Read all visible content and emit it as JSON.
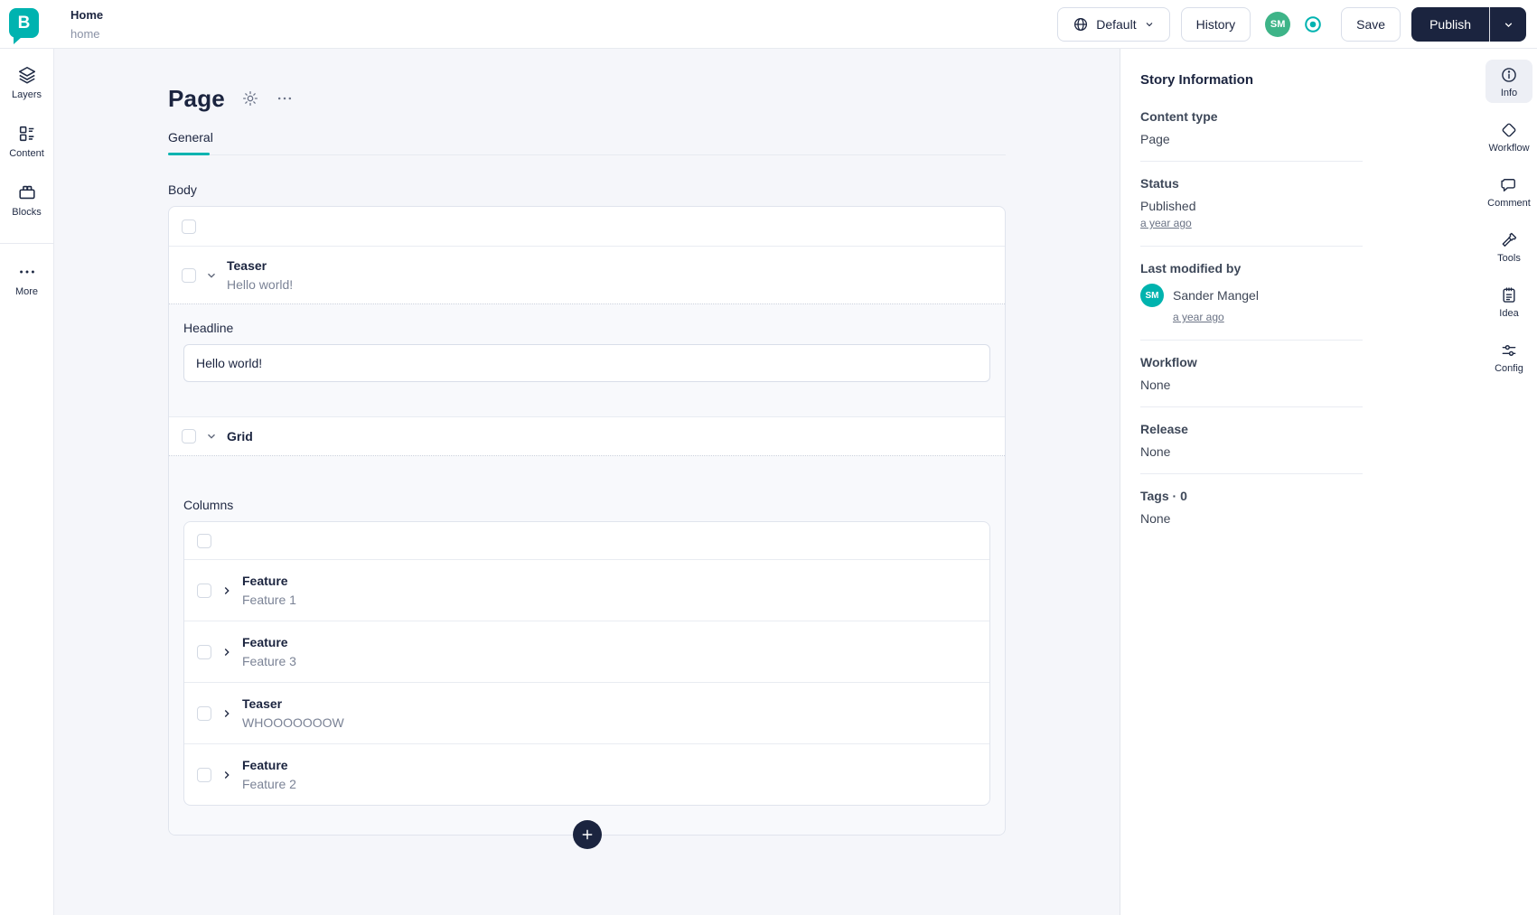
{
  "top_bar": {
    "logo_letter": "B",
    "story_title": "Home",
    "story_slug": "home",
    "language_selector_label": "Default",
    "history_label": "History",
    "avatar_initials": "SM",
    "save_label": "Save",
    "publish_label": "Publish"
  },
  "left_rail": {
    "items": [
      {
        "label": "Layers",
        "icon": "layers-icon"
      },
      {
        "label": "Content",
        "icon": "content-icon"
      },
      {
        "label": "Blocks",
        "icon": "blocks-icon"
      },
      {
        "label": "More",
        "icon": "more-icon"
      }
    ]
  },
  "editor": {
    "page_title": "Page",
    "tabs": [
      {
        "label": "General",
        "active": true
      }
    ],
    "body": {
      "label": "Body",
      "blocks": [
        {
          "type": "Teaser",
          "summary": "Hello world!",
          "expanded": true,
          "fields": [
            {
              "label": "Headline",
              "value": "Hello world!"
            }
          ]
        },
        {
          "type": "Grid",
          "expanded": true,
          "fields": [
            {
              "label": "Columns"
            }
          ],
          "children": [
            {
              "type": "Feature",
              "summary": "Feature 1"
            },
            {
              "type": "Feature",
              "summary": "Feature 3"
            },
            {
              "type": "Teaser",
              "summary": "WHOOOOOOOW"
            },
            {
              "type": "Feature",
              "summary": "Feature 2"
            }
          ]
        }
      ]
    }
  },
  "story_info": {
    "title": "Story Information",
    "content_type": {
      "label": "Content type",
      "value": "Page"
    },
    "status": {
      "label": "Status",
      "value": "Published",
      "link": "a year ago"
    },
    "last_modified": {
      "label": "Last modified by",
      "avatar_initials": "SM",
      "name": "Sander Mangel",
      "link": "a year ago"
    },
    "workflow": {
      "label": "Workflow",
      "value": "None"
    },
    "release": {
      "label": "Release",
      "value": "None"
    },
    "tags": {
      "label": "Tags · 0",
      "value": "None"
    }
  },
  "right_rail": {
    "active": "Info",
    "items": [
      {
        "label": "Info",
        "icon": "info-icon"
      },
      {
        "label": "Workflow",
        "icon": "workflow-icon"
      },
      {
        "label": "Comment",
        "icon": "comment-icon"
      },
      {
        "label": "Tools",
        "icon": "tools-icon"
      },
      {
        "label": "Idea",
        "icon": "idea-icon"
      },
      {
        "label": "Config",
        "icon": "config-icon"
      }
    ]
  },
  "colors": {
    "accent_teal": "#00b3b0",
    "ink_navy": "#1b243f",
    "avatar_green": "#3eb488",
    "canvas_bg": "#f5f6fa",
    "section_bg": "#f8f9fc",
    "border": "#e0e4ed"
  }
}
